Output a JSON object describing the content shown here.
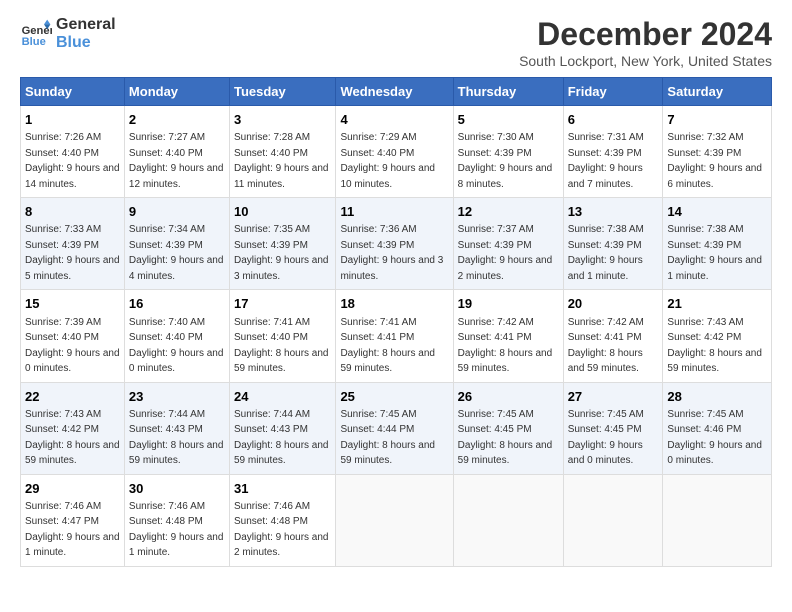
{
  "logo": {
    "line1": "General",
    "line2": "Blue"
  },
  "title": "December 2024",
  "subtitle": "South Lockport, New York, United States",
  "days_of_week": [
    "Sunday",
    "Monday",
    "Tuesday",
    "Wednesday",
    "Thursday",
    "Friday",
    "Saturday"
  ],
  "weeks": [
    [
      {
        "day": "1",
        "sunrise": "Sunrise: 7:26 AM",
        "sunset": "Sunset: 4:40 PM",
        "daylight": "Daylight: 9 hours and 14 minutes."
      },
      {
        "day": "2",
        "sunrise": "Sunrise: 7:27 AM",
        "sunset": "Sunset: 4:40 PM",
        "daylight": "Daylight: 9 hours and 12 minutes."
      },
      {
        "day": "3",
        "sunrise": "Sunrise: 7:28 AM",
        "sunset": "Sunset: 4:40 PM",
        "daylight": "Daylight: 9 hours and 11 minutes."
      },
      {
        "day": "4",
        "sunrise": "Sunrise: 7:29 AM",
        "sunset": "Sunset: 4:40 PM",
        "daylight": "Daylight: 9 hours and 10 minutes."
      },
      {
        "day": "5",
        "sunrise": "Sunrise: 7:30 AM",
        "sunset": "Sunset: 4:39 PM",
        "daylight": "Daylight: 9 hours and 8 minutes."
      },
      {
        "day": "6",
        "sunrise": "Sunrise: 7:31 AM",
        "sunset": "Sunset: 4:39 PM",
        "daylight": "Daylight: 9 hours and 7 minutes."
      },
      {
        "day": "7",
        "sunrise": "Sunrise: 7:32 AM",
        "sunset": "Sunset: 4:39 PM",
        "daylight": "Daylight: 9 hours and 6 minutes."
      }
    ],
    [
      {
        "day": "8",
        "sunrise": "Sunrise: 7:33 AM",
        "sunset": "Sunset: 4:39 PM",
        "daylight": "Daylight: 9 hours and 5 minutes."
      },
      {
        "day": "9",
        "sunrise": "Sunrise: 7:34 AM",
        "sunset": "Sunset: 4:39 PM",
        "daylight": "Daylight: 9 hours and 4 minutes."
      },
      {
        "day": "10",
        "sunrise": "Sunrise: 7:35 AM",
        "sunset": "Sunset: 4:39 PM",
        "daylight": "Daylight: 9 hours and 3 minutes."
      },
      {
        "day": "11",
        "sunrise": "Sunrise: 7:36 AM",
        "sunset": "Sunset: 4:39 PM",
        "daylight": "Daylight: 9 hours and 3 minutes."
      },
      {
        "day": "12",
        "sunrise": "Sunrise: 7:37 AM",
        "sunset": "Sunset: 4:39 PM",
        "daylight": "Daylight: 9 hours and 2 minutes."
      },
      {
        "day": "13",
        "sunrise": "Sunrise: 7:38 AM",
        "sunset": "Sunset: 4:39 PM",
        "daylight": "Daylight: 9 hours and 1 minute."
      },
      {
        "day": "14",
        "sunrise": "Sunrise: 7:38 AM",
        "sunset": "Sunset: 4:39 PM",
        "daylight": "Daylight: 9 hours and 1 minute."
      }
    ],
    [
      {
        "day": "15",
        "sunrise": "Sunrise: 7:39 AM",
        "sunset": "Sunset: 4:40 PM",
        "daylight": "Daylight: 9 hours and 0 minutes."
      },
      {
        "day": "16",
        "sunrise": "Sunrise: 7:40 AM",
        "sunset": "Sunset: 4:40 PM",
        "daylight": "Daylight: 9 hours and 0 minutes."
      },
      {
        "day": "17",
        "sunrise": "Sunrise: 7:41 AM",
        "sunset": "Sunset: 4:40 PM",
        "daylight": "Daylight: 8 hours and 59 minutes."
      },
      {
        "day": "18",
        "sunrise": "Sunrise: 7:41 AM",
        "sunset": "Sunset: 4:41 PM",
        "daylight": "Daylight: 8 hours and 59 minutes."
      },
      {
        "day": "19",
        "sunrise": "Sunrise: 7:42 AM",
        "sunset": "Sunset: 4:41 PM",
        "daylight": "Daylight: 8 hours and 59 minutes."
      },
      {
        "day": "20",
        "sunrise": "Sunrise: 7:42 AM",
        "sunset": "Sunset: 4:41 PM",
        "daylight": "Daylight: 8 hours and 59 minutes."
      },
      {
        "day": "21",
        "sunrise": "Sunrise: 7:43 AM",
        "sunset": "Sunset: 4:42 PM",
        "daylight": "Daylight: 8 hours and 59 minutes."
      }
    ],
    [
      {
        "day": "22",
        "sunrise": "Sunrise: 7:43 AM",
        "sunset": "Sunset: 4:42 PM",
        "daylight": "Daylight: 8 hours and 59 minutes."
      },
      {
        "day": "23",
        "sunrise": "Sunrise: 7:44 AM",
        "sunset": "Sunset: 4:43 PM",
        "daylight": "Daylight: 8 hours and 59 minutes."
      },
      {
        "day": "24",
        "sunrise": "Sunrise: 7:44 AM",
        "sunset": "Sunset: 4:43 PM",
        "daylight": "Daylight: 8 hours and 59 minutes."
      },
      {
        "day": "25",
        "sunrise": "Sunrise: 7:45 AM",
        "sunset": "Sunset: 4:44 PM",
        "daylight": "Daylight: 8 hours and 59 minutes."
      },
      {
        "day": "26",
        "sunrise": "Sunrise: 7:45 AM",
        "sunset": "Sunset: 4:45 PM",
        "daylight": "Daylight: 8 hours and 59 minutes."
      },
      {
        "day": "27",
        "sunrise": "Sunrise: 7:45 AM",
        "sunset": "Sunset: 4:45 PM",
        "daylight": "Daylight: 9 hours and 0 minutes."
      },
      {
        "day": "28",
        "sunrise": "Sunrise: 7:45 AM",
        "sunset": "Sunset: 4:46 PM",
        "daylight": "Daylight: 9 hours and 0 minutes."
      }
    ],
    [
      {
        "day": "29",
        "sunrise": "Sunrise: 7:46 AM",
        "sunset": "Sunset: 4:47 PM",
        "daylight": "Daylight: 9 hours and 1 minute."
      },
      {
        "day": "30",
        "sunrise": "Sunrise: 7:46 AM",
        "sunset": "Sunset: 4:48 PM",
        "daylight": "Daylight: 9 hours and 1 minute."
      },
      {
        "day": "31",
        "sunrise": "Sunrise: 7:46 AM",
        "sunset": "Sunset: 4:48 PM",
        "daylight": "Daylight: 9 hours and 2 minutes."
      },
      null,
      null,
      null,
      null
    ]
  ]
}
